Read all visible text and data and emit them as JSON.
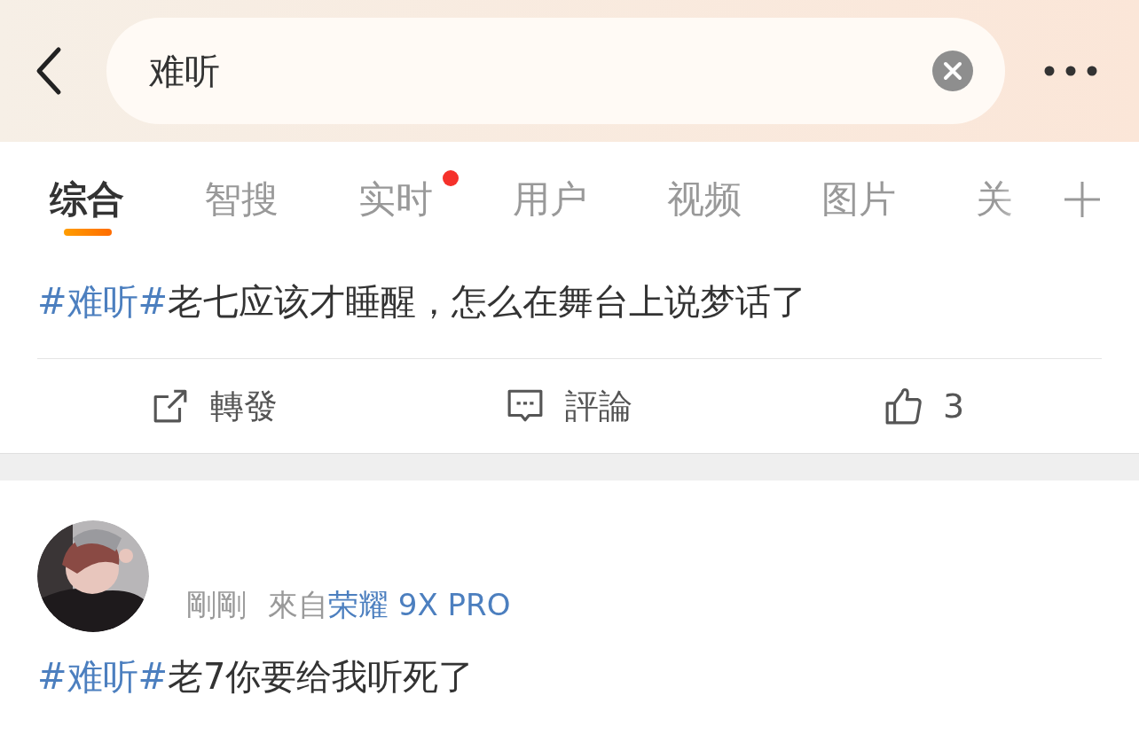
{
  "search": {
    "value": "难听"
  },
  "tabs": [
    {
      "label": "综合",
      "selected": true,
      "dot": false
    },
    {
      "label": "智搜",
      "selected": false,
      "dot": false
    },
    {
      "label": "实时",
      "selected": false,
      "dot": true
    },
    {
      "label": "用户",
      "selected": false,
      "dot": false
    },
    {
      "label": "视频",
      "selected": false,
      "dot": false
    },
    {
      "label": "图片",
      "selected": false,
      "dot": false
    },
    {
      "label": "关",
      "selected": false,
      "dot": false
    }
  ],
  "posts": [
    {
      "text": "**#难听#**老七应该才睡醒，怎么在舞台上说梦话了",
      "actions": [
        {
          "kind": "repost",
          "label": "轉發"
        },
        {
          "kind": "comment",
          "label": "評論"
        },
        {
          "kind": "like",
          "label": "3"
        }
      ]
    },
    {
      "time": "剛剛",
      "source_prefix": "來自",
      "source": "荣耀 9X PRO",
      "text": "**#难听#**老7你要给我听死了"
    }
  ]
}
